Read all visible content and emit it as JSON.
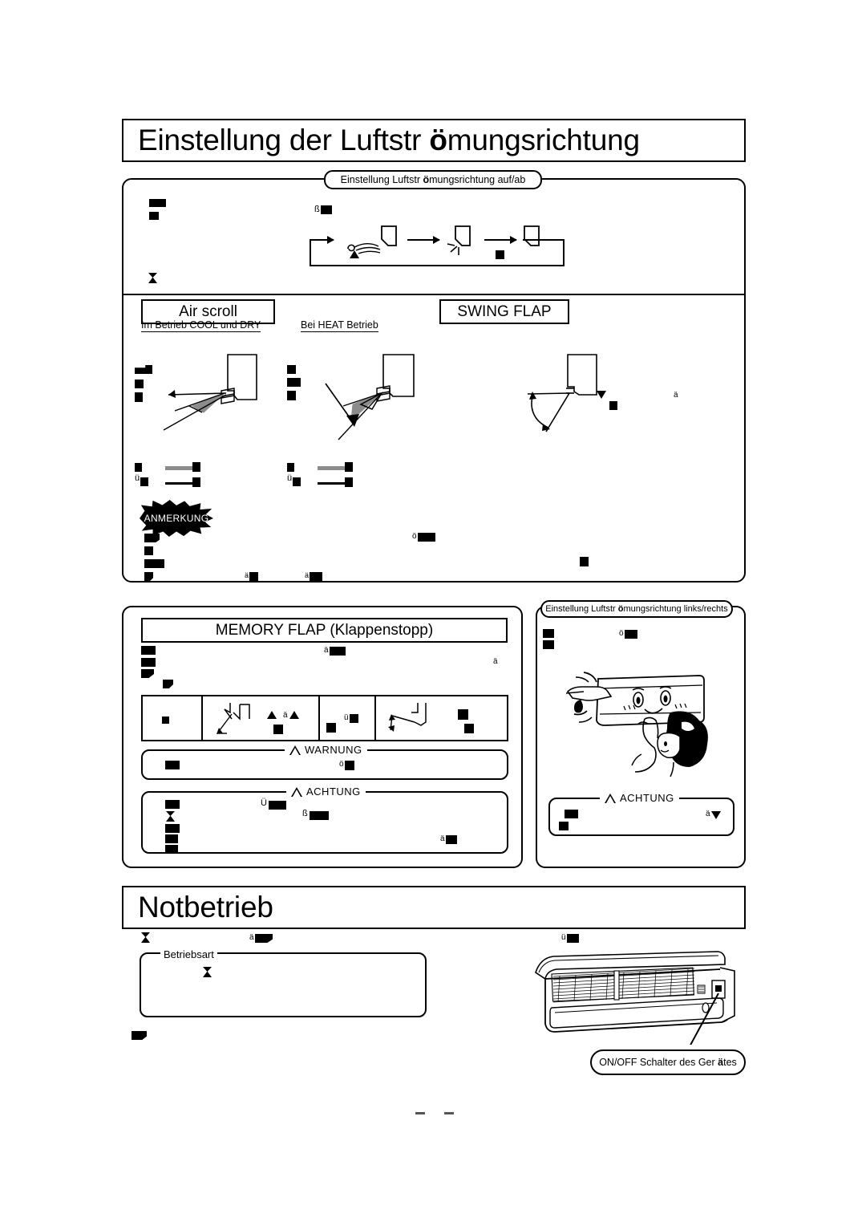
{
  "document": {
    "language": "de",
    "kind": "appliance-manual-page"
  },
  "sections": {
    "airflow": {
      "title_prefix": "Einstellung der Luftstr ",
      "title_bold": "ö",
      "title_suffix": "mungsrichtung",
      "panel_caption_prefix": "Einstellung Luftstr ",
      "panel_caption_bold": "ö",
      "panel_caption_suffix": "mungsrichtung auf/ab"
    },
    "air_scroll": {
      "caption": "Air scroll",
      "cool_dry_heading": "Im Betrieb COOL und DRY",
      "heat_heading": "Bei HEAT Betrieb"
    },
    "swing_flap": {
      "caption": "SWING FLAP"
    },
    "note": {
      "badge": "ANMERKUNG"
    },
    "memory_flap": {
      "caption": "MEMORY FLAP (Klappenstopp)",
      "warning_label": "WARNUNG",
      "caution_label": "ACHTUNG"
    },
    "left_right": {
      "panel_caption_prefix": "Einstellung Luftstr ",
      "panel_caption_bold": "ö",
      "panel_caption_suffix": "mungsrichtung links/rechts",
      "caution_label": "ACHTUNG"
    },
    "emergency": {
      "title": "Notbetrieb",
      "mode_box_label": "Betriebsart",
      "callout_prefix": "ON/OFF Schalter des Ger ",
      "callout_bold": "ä",
      "callout_suffix": "tes"
    }
  },
  "glyph_fragments": {
    "eszett": "ß",
    "o_umlaut": "ö",
    "a_umlaut": "ä",
    "u_umlaut": "ü",
    "U_umlaut": "Ü"
  },
  "colors": {
    "ink": "#000000",
    "paper": "#ffffff",
    "gray_arrow": "#808080",
    "page_mark": "#555555"
  }
}
